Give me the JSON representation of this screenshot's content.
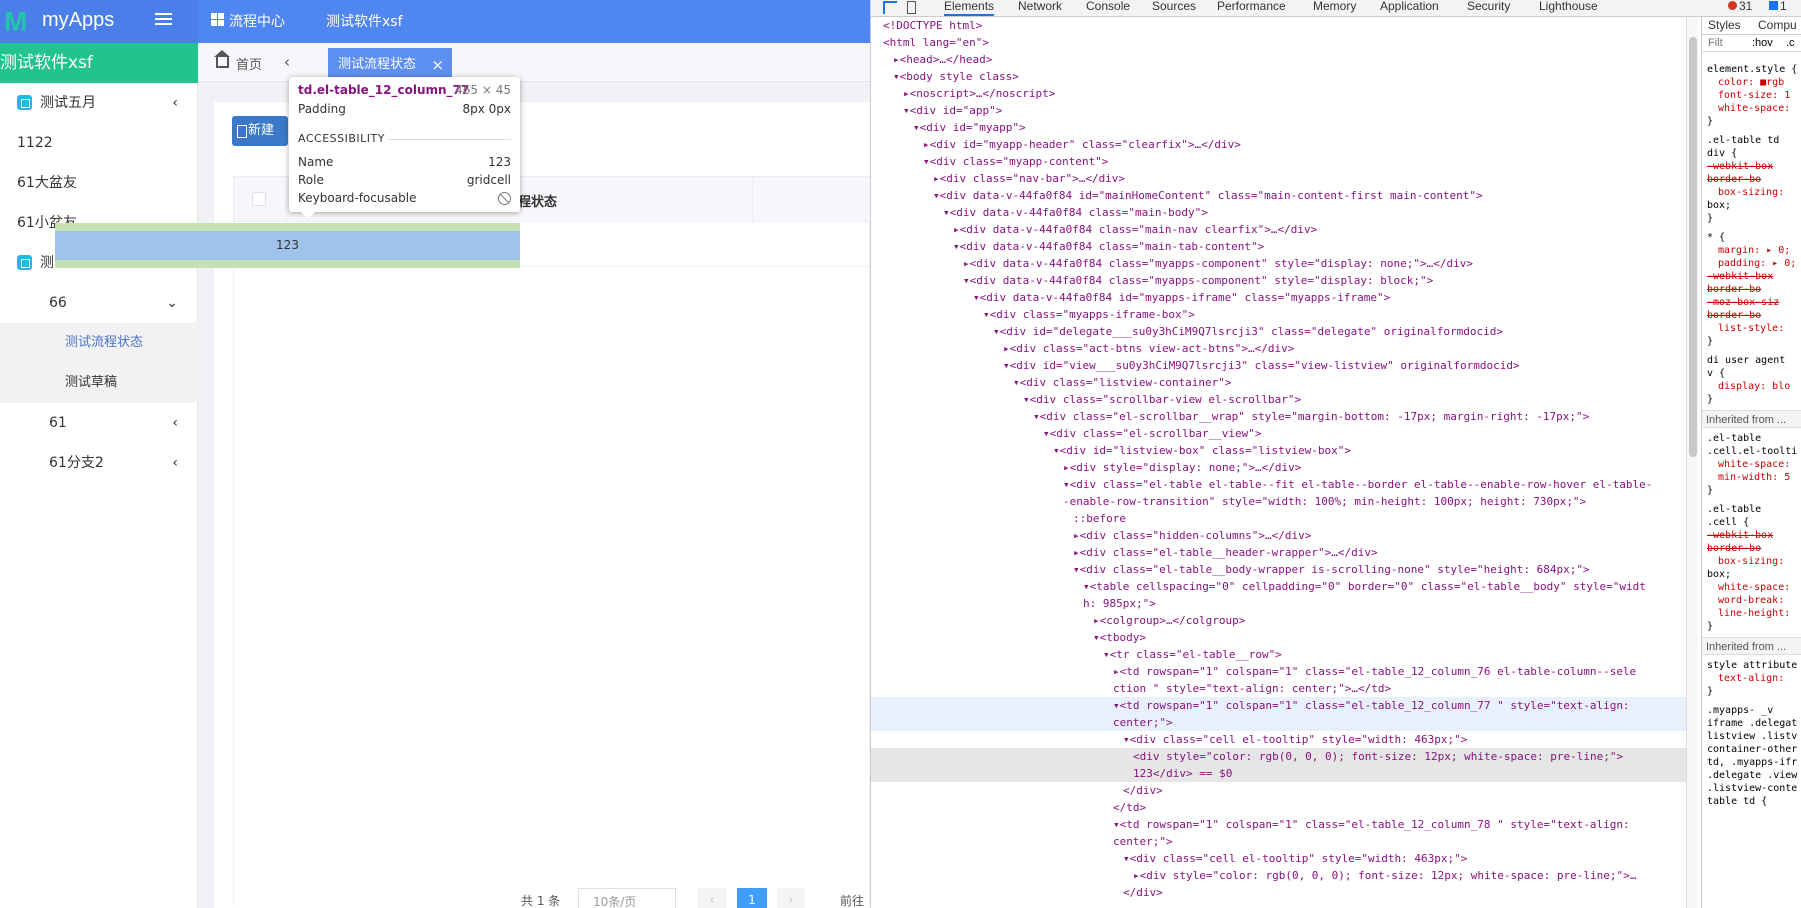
{
  "app": {
    "logo": "myApps",
    "topnav": [
      "流程中心",
      "测试软件xsf"
    ],
    "sidebar_title": "测试软件xsf",
    "sidebar_items": [
      {
        "label": "测试五月",
        "arrow": "‹"
      },
      {
        "label": "1122"
      },
      {
        "label": "61大盆友"
      },
      {
        "label": "61小盆友"
      },
      {
        "label": "测试六月",
        "arrow": "⌄"
      },
      {
        "label": "66",
        "arrow": "⌄"
      },
      {
        "label": "测试流程状态"
      },
      {
        "label": "测试草稿"
      },
      {
        "label": "61",
        "arrow": "‹"
      },
      {
        "label": "61分支2",
        "arrow": "‹"
      }
    ],
    "tabs": {
      "home": "首页",
      "active": "测试流程状态",
      "close": "×",
      "back": "‹"
    },
    "new_button": "新建",
    "table": {
      "header_fragment": "程状态",
      "cell_value": "123"
    },
    "pager": {
      "total": "共 1 条",
      "page_size": "10条/页",
      "prev": "‹",
      "current": "1",
      "next": "›",
      "goto": "前往"
    }
  },
  "tooltip": {
    "title": "td.el-table_12_column_77",
    "dimensions": "465 × 45",
    "padding_label": "Padding",
    "padding_value": "8px 0px",
    "section": "ACCESSIBILITY",
    "rows": [
      {
        "label": "Name",
        "value": "123"
      },
      {
        "label": "Role",
        "value": "gridcell"
      },
      {
        "label": "Keyboard-focusable",
        "value": ""
      }
    ]
  },
  "devtools": {
    "tabs": [
      "Elements",
      "Network",
      "Console",
      "Sources",
      "Performance",
      "Memory",
      "Application",
      "Security",
      "Lighthouse"
    ],
    "errors": "31",
    "warnings": "1",
    "styles_tabs": [
      "Styles",
      "Compu"
    ],
    "filter": "Filt",
    "hov": ":hov",
    "cls": ".c",
    "dom_lines": [
      "<!DOCTYPE html>",
      "<html lang=\"en\">",
      "▸<head>…</head>",
      "▾<body style class>",
      "▸<noscript>…</noscript>",
      "▾<div id=\"app\">",
      "▾<div id=\"myapp\">",
      "▸<div id=\"myapp-header\" class=\"clearfix\">…</div>",
      "▾<div class=\"myapp-content\">",
      "▸<div class=\"nav-bar\">…</div>",
      "▾<div data-v-44fa0f84 id=\"mainHomeContent\" class=\"main-content-first main-content\">",
      "▾<div data-v-44fa0f84 class=\"main-body\">",
      "▸<div data-v-44fa0f84 class=\"main-nav clearfix\">…</div>",
      "▾<div data-v-44fa0f84 class=\"main-tab-content\">",
      "▸<div data-v-44fa0f84 class=\"myapps-component\" style=\"display: none;\">…</div>",
      "▾<div data-v-44fa0f84 class=\"myapps-component\" style=\"display: block;\">",
      "▾<div data-v-44fa0f84 id=\"myapps-iframe\" class=\"myapps-iframe\">",
      "▾<div class=\"myapps-iframe-box\">",
      "▾<div id=\"delegate___su0y3hCiM9Q7lsrcji3\" class=\"delegate\" originalformdocid>",
      "▸<div class=\"act-btns view-act-btns\">…</div>",
      "▾<div id=\"view___su0y3hCiM9Q7lsrcji3\" class=\"view-listview\" originalformdocid>",
      "▾<div class=\"listview-container\">",
      "▾<div class=\"scrollbar-view el-scrollbar\">",
      "▾<div class=\"el-scrollbar__wrap\" style=\"margin-bottom: -17px; margin-right: -17px;\">",
      "▾<div class=\"el-scrollbar__view\">",
      "▾<div id=\"listview-box\" class=\"listview-box\">",
      "▸<div style=\"display: none;\">…</div>",
      "▾<div class=\"el-table el-table--fit el-table--border el-table--enable-row-hover el-table-",
      "-enable-row-transition\" style=\"width: 100%; min-height: 100px; height: 730px;\">",
      "::before",
      "▸<div class=\"hidden-columns\">…</div>",
      "▸<div class=\"el-table__header-wrapper\">…</div>",
      "▾<div class=\"el-table__body-wrapper is-scrolling-none\" style=\"height: 684px;\">",
      "▾<table cellspacing=\"0\" cellpadding=\"0\" border=\"0\" class=\"el-table__body\" style=\"widt",
      "h: 985px;\">",
      "▸<colgroup>…</colgroup>",
      "▾<tbody>",
      "▾<tr class=\"el-table__row\">",
      "▸<td rowspan=\"1\" colspan=\"1\" class=\"el-table_12_column_76  el-table-column--sele",
      "ction \" style=\"text-align: center;\">…</td>",
      "▾<td rowspan=\"1\" colspan=\"1\" class=\"el-table_12_column_77   \" style=\"text-align:",
      "center;\">",
      "▾<div class=\"cell el-tooltip\" style=\"width: 463px;\">",
      "<div style=\"color: rgb(0, 0, 0); font-size: 12px; white-space: pre-line;\">",
      "123</div> == $0",
      "</div>",
      "</td>",
      "▾<td rowspan=\"1\" colspan=\"1\" class=\"el-table_12_column_78   \" style=\"text-align:",
      "center;\">",
      "▾<div class=\"cell el-tooltip\" style=\"width: 463px;\">",
      "▸<div style=\"color: rgb(0, 0, 0); font-size: 12px; white-space: pre-line;\">…",
      "</div>"
    ],
    "styles_lines": [
      "element.style {",
      "color: ■rgb",
      "font-size: 1",
      "white-space:",
      "}",
      ".el-table td",
      "div {",
      "-webkit-box",
      "border-bo",
      "box-sizing:",
      "box;",
      "}",
      "* {",
      "margin: ▸ 0;",
      "padding: ▸ 0;",
      "-webkit-box",
      "border-bo",
      "-moz-box-siz",
      "border-bo",
      "list-style:",
      "}",
      "di   user agent",
      "v {",
      "display: blo",
      "}",
      "Inherited from ...",
      ".el-table",
      ".cell.el-toolti",
      "white-space:",
      "min-width: 5",
      "}",
      ".el-table",
      ".cell {",
      "-webkit-box",
      "border-bo",
      "box-sizing:",
      "box;",
      "white-space:",
      "word-break:",
      "line-height:",
      "}",
      "Inherited from ...",
      "style attribute",
      "text-align:",
      "}",
      ".myapps-     _v",
      "iframe .delegat",
      "listview .listv",
      "container-other",
      "td, .myapps-ifr",
      ".delegate .view",
      ".listview-conte",
      "table td {"
    ]
  }
}
